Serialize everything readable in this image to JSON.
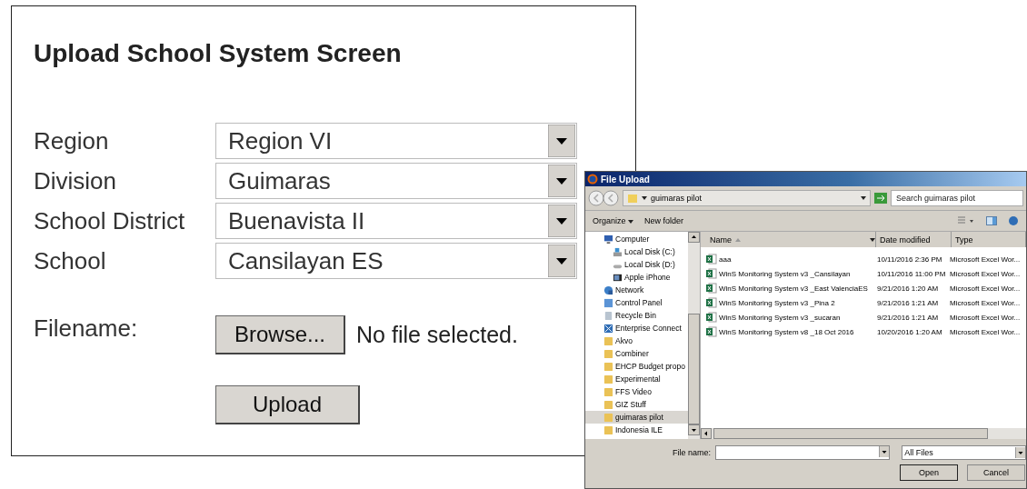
{
  "form": {
    "title": "Upload School System Screen",
    "fields": [
      {
        "label": "Region",
        "value": "Region VI"
      },
      {
        "label": "Division",
        "value": "Guimaras"
      },
      {
        "label": "School District",
        "value": "Buenavista II"
      },
      {
        "label": "School",
        "value": "Cansilayan ES"
      }
    ],
    "filename_label": "Filename:",
    "browse_button": "Browse...",
    "file_status": "No file selected.",
    "upload_button": "Upload"
  },
  "dialog": {
    "title": "File Upload",
    "path": "guimaras pilot",
    "search": {
      "placeholder": "Search guimaras pilot"
    },
    "organize": "Organize",
    "new_folder": "New folder",
    "tree": [
      {
        "label": "Computer",
        "kind": "computer",
        "selected": false,
        "children": [
          {
            "label": "Local Disk (C:)",
            "kind": "system-disk",
            "selected": false
          },
          {
            "label": "Local Disk (D:)",
            "kind": "disk",
            "selected": false
          },
          {
            "label": "Apple iPhone",
            "kind": "phone",
            "selected": false
          }
        ]
      },
      {
        "label": "Network",
        "kind": "network",
        "selected": false
      },
      {
        "label": "Control Panel",
        "kind": "control",
        "selected": false
      },
      {
        "label": "Recycle Bin",
        "kind": "recycle",
        "selected": false
      },
      {
        "label": "Enterprise Connect",
        "kind": "enterprise",
        "selected": false
      },
      {
        "label": "Akvo",
        "kind": "folder",
        "selected": false
      },
      {
        "label": "Combiner",
        "kind": "folder",
        "selected": false
      },
      {
        "label": "EHCP Budget propo",
        "kind": "folder",
        "selected": false
      },
      {
        "label": "Experimental",
        "kind": "folder",
        "selected": false
      },
      {
        "label": "FFS Video",
        "kind": "folder",
        "selected": false
      },
      {
        "label": "GIZ Stuff",
        "kind": "folder",
        "selected": false
      },
      {
        "label": "guimaras pilot",
        "kind": "folder",
        "selected": true
      },
      {
        "label": "Indonesia ILE",
        "kind": "folder",
        "selected": false
      }
    ],
    "columns": [
      "Name",
      "Date modified",
      "Type"
    ],
    "files": [
      {
        "name": "aaa",
        "date": "10/11/2016 2:36 PM",
        "type": "Microsoft Excel Wor..."
      },
      {
        "name": "WinS Monitoring System v3 _Cansilayan",
        "date": "10/11/2016 11:00 PM",
        "type": "Microsoft Excel Wor..."
      },
      {
        "name": "WinS Monitoring System v3 _East ValenciaES",
        "date": "9/21/2016 1:20 AM",
        "type": "Microsoft Excel Wor..."
      },
      {
        "name": "WinS Monitoring System v3 _Pina 2",
        "date": "9/21/2016 1:21 AM",
        "type": "Microsoft Excel Wor..."
      },
      {
        "name": "WinS Monitoring System v3 _sucaran",
        "date": "9/21/2016 1:21 AM",
        "type": "Microsoft Excel Wor..."
      },
      {
        "name": "WinS Monitoring System v8 _18 Oct 2016",
        "date": "10/20/2016 1:20 AM",
        "type": "Microsoft Excel Wor..."
      }
    ],
    "file_name_label": "File name:",
    "filter": "All Files",
    "open_button": "Open",
    "cancel_button": "Cancel"
  }
}
